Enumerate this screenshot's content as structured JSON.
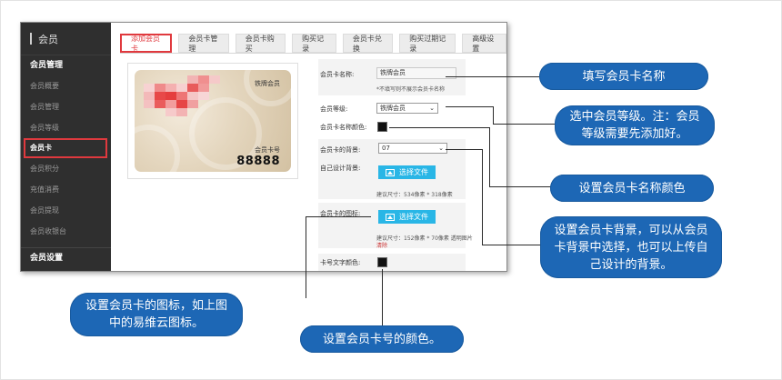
{
  "sidebar": {
    "header": "会员",
    "section_title": "会员管理",
    "items": [
      {
        "label": "会员概要"
      },
      {
        "label": "会员管理"
      },
      {
        "label": "会员等级"
      },
      {
        "label": "会员卡"
      },
      {
        "label": "会员积分"
      },
      {
        "label": "充值消费"
      },
      {
        "label": "会员提现"
      },
      {
        "label": "会员收银台"
      }
    ],
    "active_index": 3,
    "bottom_section": "会员设置"
  },
  "tabs": [
    {
      "label": "添加会员卡",
      "active": true
    },
    {
      "label": "会员卡管理",
      "active": false
    },
    {
      "label": "会员卡购买",
      "active": false
    },
    {
      "label": "购买记录",
      "active": false
    },
    {
      "label": "会员卡兑换",
      "active": false
    },
    {
      "label": "购买过期记录",
      "active": false
    },
    {
      "label": "高级设置",
      "active": false
    }
  ],
  "card_preview": {
    "level_text": "铁牌会员",
    "card_no_label": "会员卡号",
    "card_no": "88888"
  },
  "form": {
    "name_label": "会员卡名称:",
    "name_value": "铁牌会员",
    "name_hint": "*不填写则不展示会员卡名称",
    "level_label": "会员等级:",
    "level_value": "铁牌会员",
    "name_color_label": "会员卡名称颜色:",
    "bg_label": "会员卡的背景:",
    "bg_value": "07",
    "custom_bg_label": "自己设计背景:",
    "bg_upload": "选择文件",
    "bg_size_hint": "建议尺寸：534像素 * 318像素",
    "icon_label": "会员卡的图标:",
    "icon_upload": "选择文件",
    "icon_size_hint": "建议尺寸：152像素 * 70像素 透明图片",
    "icon_remove": "清除",
    "number_color_label": "卡号文字颜色:"
  },
  "callouts": {
    "name": "填写会员卡名称",
    "level": "选中会员等级。注：会员等级需要先添加好。",
    "name_color": "设置会员卡名称颜色",
    "background": "设置会员卡背景，可以从会员卡背景中选择，也可以上传自己设计的背景。",
    "icon": "设置会员卡的图标，如上图中的易维云图标。",
    "number_color": "设置会员卡号的颜色。"
  },
  "colors": {
    "accent": "#e0393e",
    "callout": "#1d67b5",
    "upload_button": "#29b6e6",
    "sidebar": "#2f2f2f"
  }
}
